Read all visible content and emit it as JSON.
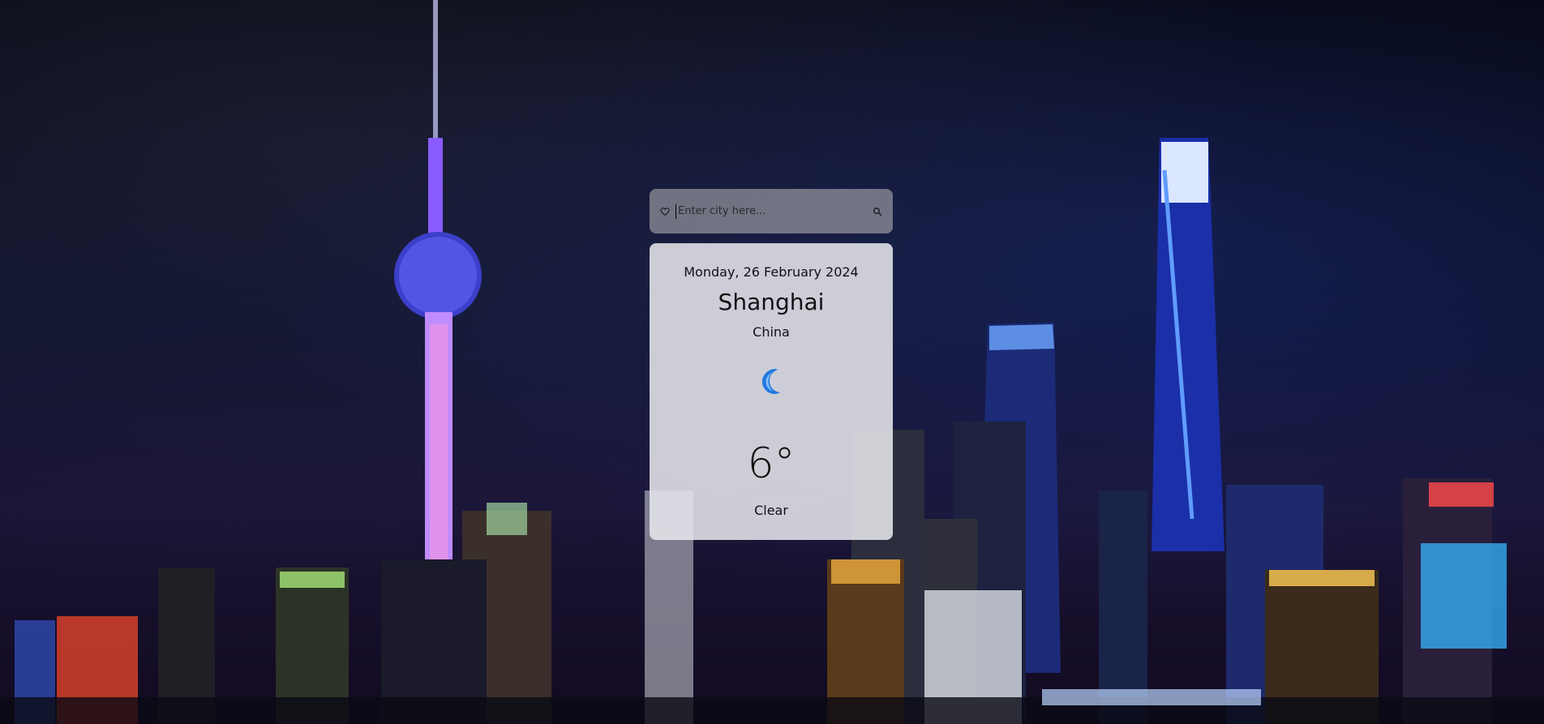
{
  "search": {
    "placeholder": "Enter city here...",
    "value": ""
  },
  "weather": {
    "date": "Monday, 26 February 2024",
    "city": "Shanghai",
    "country": "China",
    "icon": "crescent-moon-icon",
    "temperature": "6°",
    "condition": "Clear"
  },
  "colors": {
    "moon": "#1f7ae0"
  }
}
